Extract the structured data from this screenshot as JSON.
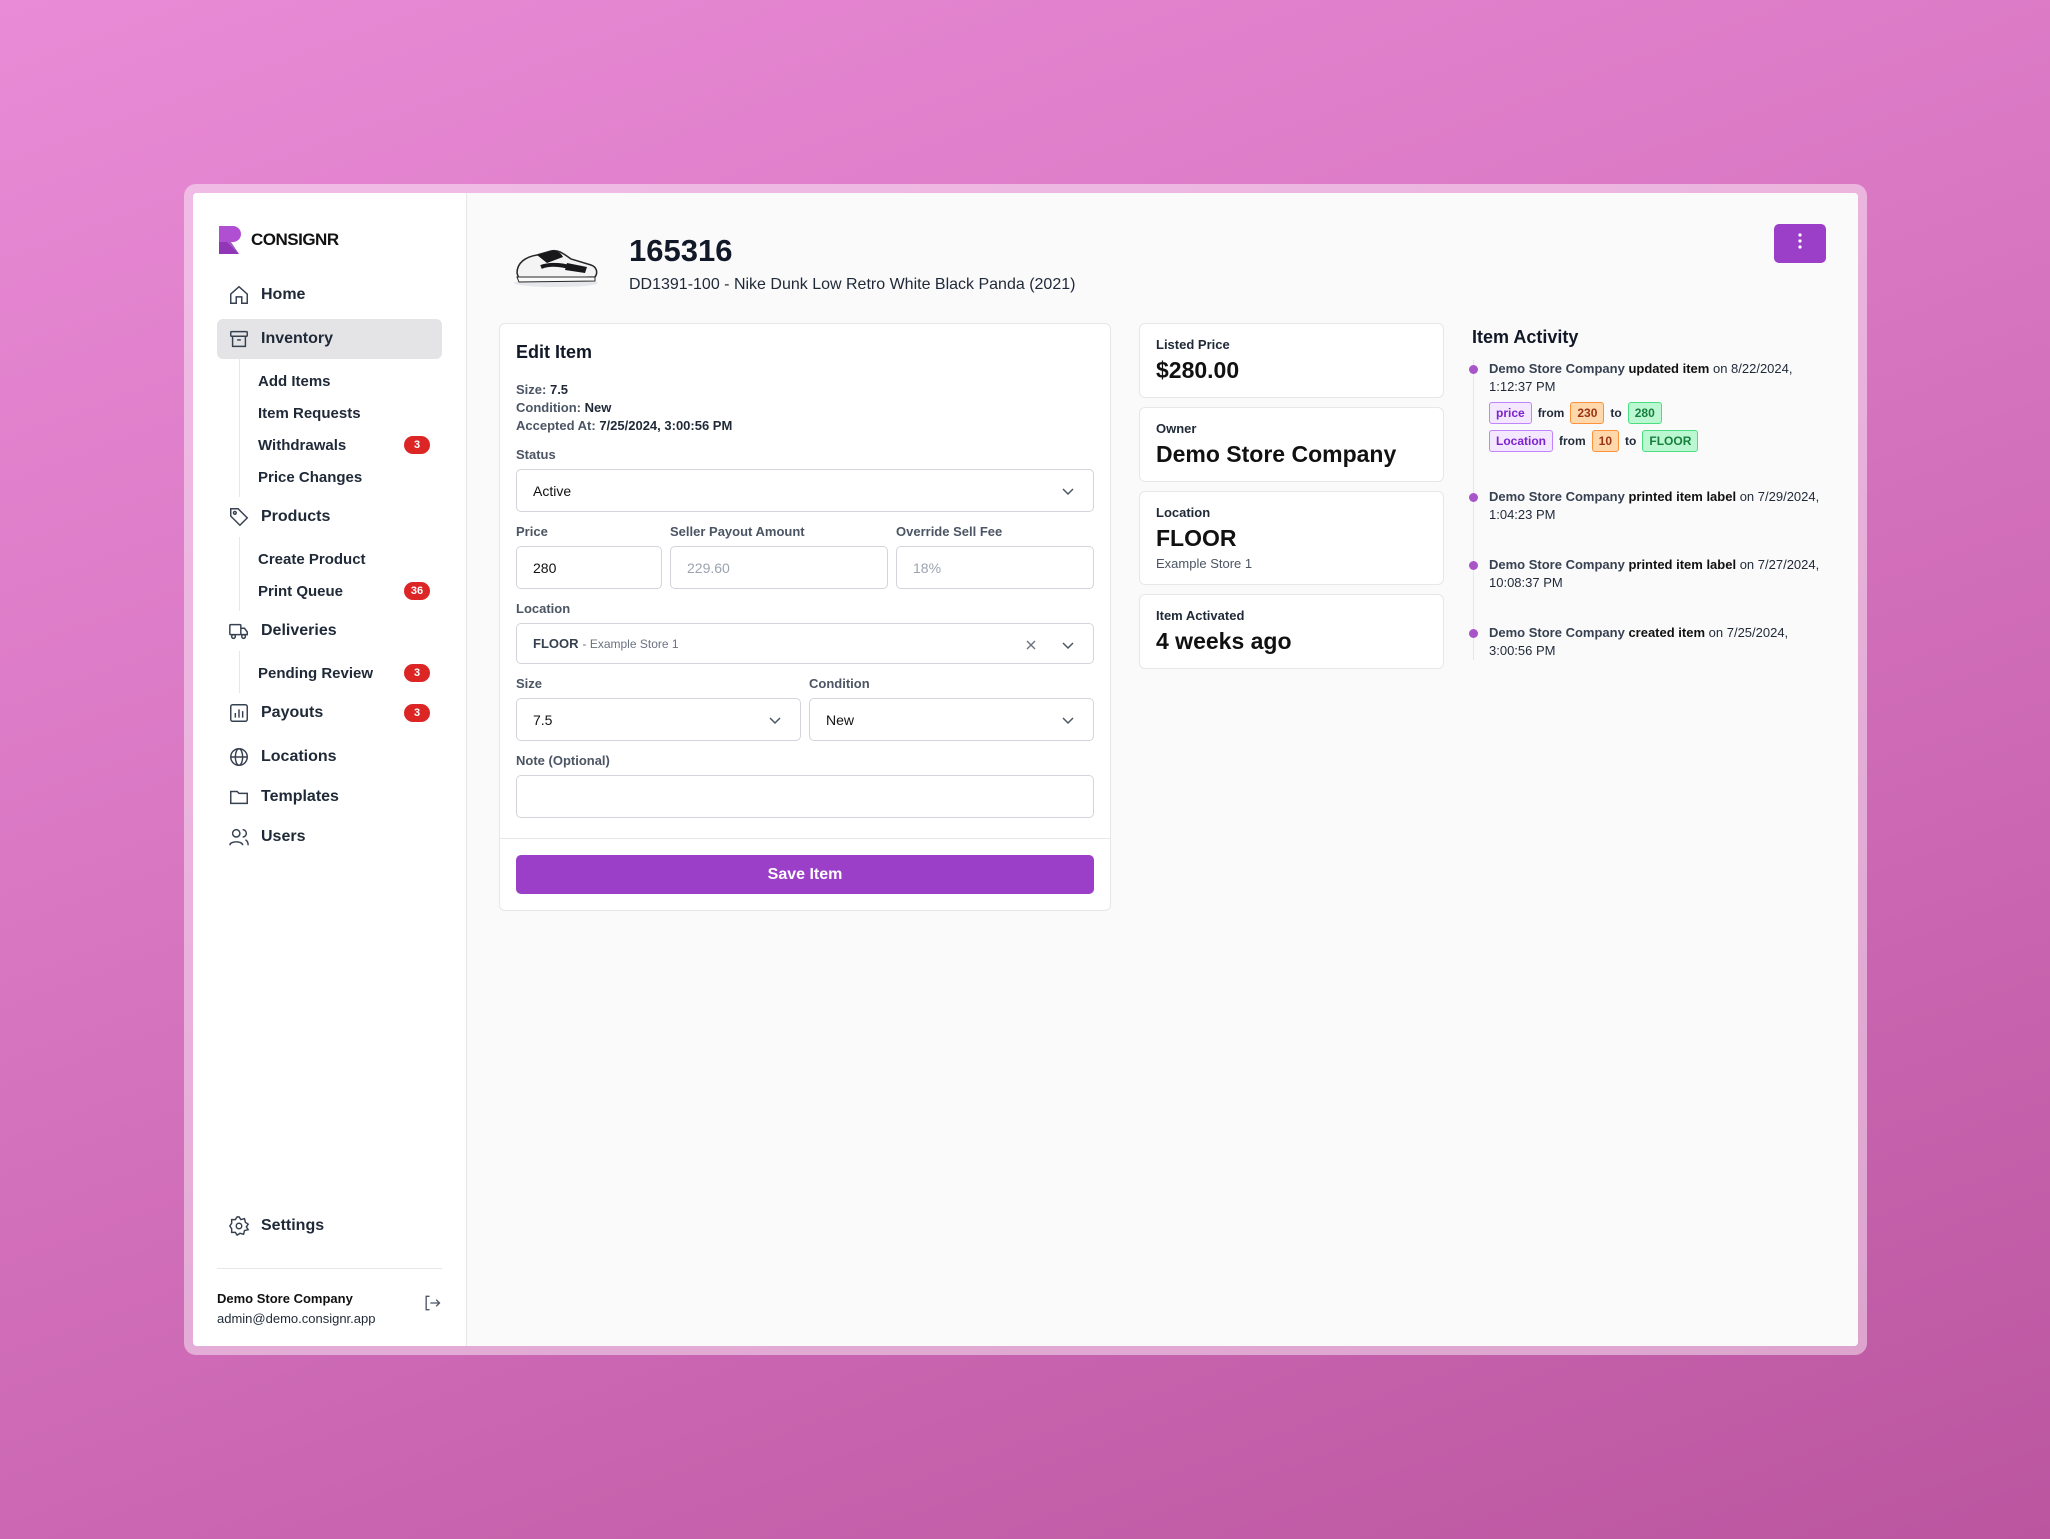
{
  "brand": {
    "name": "CONSIGNR"
  },
  "nav": {
    "home": "Home",
    "inventory": "Inventory",
    "inventory_sub": [
      {
        "label": "Add Items",
        "badge": null
      },
      {
        "label": "Item Requests",
        "badge": null
      },
      {
        "label": "Withdrawals",
        "badge": "3"
      },
      {
        "label": "Price Changes",
        "badge": null
      }
    ],
    "products": "Products",
    "products_sub": [
      {
        "label": "Create Product",
        "badge": null
      },
      {
        "label": "Print Queue",
        "badge": "36"
      }
    ],
    "deliveries": "Deliveries",
    "deliveries_sub": [
      {
        "label": "Pending Review",
        "badge": "3"
      }
    ],
    "payouts": "Payouts",
    "payouts_badge": "3",
    "locations": "Locations",
    "templates": "Templates",
    "users": "Users",
    "settings": "Settings"
  },
  "account": {
    "name": "Demo Store Company",
    "email": "admin@demo.consignr.app"
  },
  "item": {
    "id": "165316",
    "description": "DD1391-100 - Nike Dunk Low Retro White Black Panda (2021)"
  },
  "edit": {
    "title": "Edit Item",
    "size_label": "Size:",
    "size_value": "7.5",
    "condition_label": "Condition:",
    "condition_value": "New",
    "accepted_label": "Accepted At:",
    "accepted_value": "7/25/2024, 3:00:56 PM",
    "status_label": "Status",
    "status_value": "Active",
    "price_label": "Price",
    "price_value": "280",
    "payout_label": "Seller Payout Amount",
    "payout_placeholder": "229.60",
    "fee_label": "Override Sell Fee",
    "fee_placeholder": "18%",
    "location_label": "Location",
    "location_value": "FLOOR",
    "location_sub": "- Example Store 1",
    "size_field_label": "Size",
    "size_field_value": "7.5",
    "condition_field_label": "Condition",
    "condition_field_value": "New",
    "note_label": "Note (Optional)",
    "note_value": "",
    "save_label": "Save Item"
  },
  "stats": {
    "listed_price_label": "Listed Price",
    "listed_price": "$280.00",
    "owner_label": "Owner",
    "owner": "Demo Store Company",
    "location_label": "Location",
    "location": "FLOOR",
    "location_sub": "Example Store 1",
    "activated_label": "Item Activated",
    "activated": "4 weeks ago"
  },
  "activity": {
    "title": "Item Activity",
    "entries": [
      {
        "who": "Demo Store Company",
        "action": "updated item",
        "when": "on 8/22/2024, 1:12:37 PM",
        "changes": [
          {
            "key": "price",
            "from_word": "from",
            "old": "230",
            "to_word": "to",
            "new": "280"
          },
          {
            "key": "Location",
            "from_word": "from",
            "old": "10",
            "to_word": "to",
            "new": "FLOOR"
          }
        ]
      },
      {
        "who": "Demo Store Company",
        "action": "printed item label",
        "when": "on 7/29/2024, 1:04:23 PM"
      },
      {
        "who": "Demo Store Company",
        "action": "printed item label",
        "when": "on 7/27/2024, 10:08:37 PM"
      },
      {
        "who": "Demo Store Company",
        "action": "created item",
        "when": "on 7/25/2024, 3:00:56 PM"
      }
    ]
  },
  "colors": {
    "accent": "#9b3fc9",
    "badge": "#dc2626"
  },
  "icons": [
    "home-icon",
    "archive-icon",
    "tag-icon",
    "truck-icon",
    "bar-chart-icon",
    "globe-icon",
    "folder-icon",
    "users-icon",
    "gear-icon",
    "logout-icon",
    "more-vertical-icon",
    "chevron-down-icon",
    "close-icon"
  ]
}
